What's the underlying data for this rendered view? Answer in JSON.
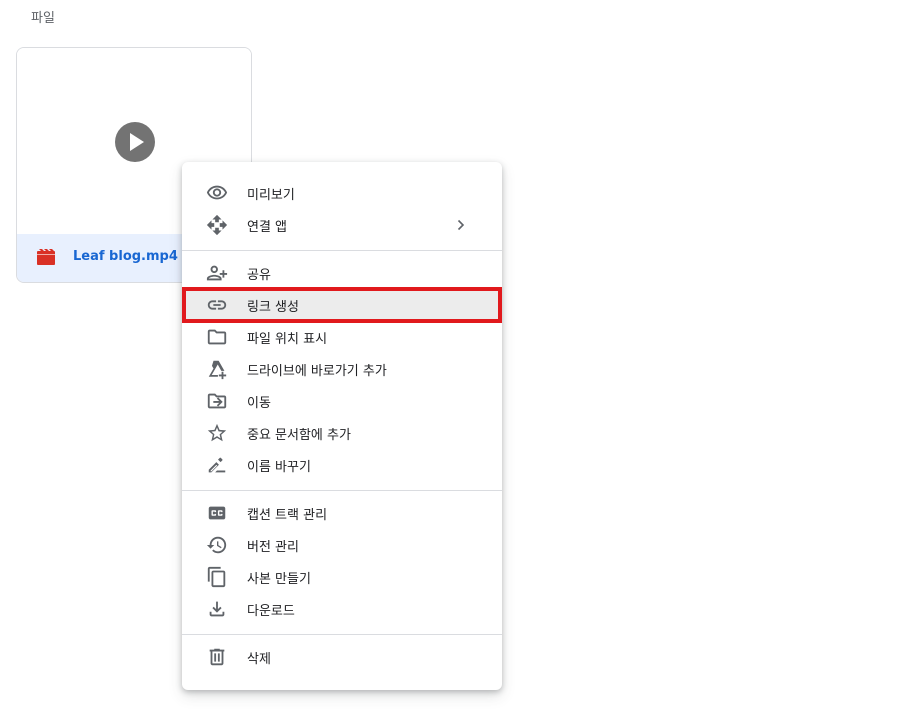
{
  "section": {
    "title": "파일"
  },
  "file_card": {
    "name": "Leaf blog.mp4",
    "type_icon": "video-file-icon",
    "thumbnail_icon": "play-icon"
  },
  "context_menu": {
    "items": [
      {
        "label": "미리보기",
        "icon": "eye-icon"
      },
      {
        "label": "연결 앱",
        "icon": "open-with-icon",
        "submenu": true
      },
      {
        "label": "공유",
        "icon": "person-add-icon"
      },
      {
        "label": "링크 생성",
        "icon": "link-icon",
        "highlighted": true
      },
      {
        "label": "파일 위치 표시",
        "icon": "folder-icon"
      },
      {
        "label": "드라이브에 바로가기 추가",
        "icon": "drive-shortcut-icon"
      },
      {
        "label": "이동",
        "icon": "move-to-folder-icon"
      },
      {
        "label": "중요 문서함에 추가",
        "icon": "star-icon"
      },
      {
        "label": "이름 바꾸기",
        "icon": "rename-pencil-icon"
      },
      {
        "label": "캡션 트랙 관리",
        "icon": "closed-caption-icon"
      },
      {
        "label": "버전 관리",
        "icon": "history-icon"
      },
      {
        "label": "사본 만들기",
        "icon": "copy-icon"
      },
      {
        "label": "다운로드",
        "icon": "download-icon"
      },
      {
        "label": "삭제",
        "icon": "trash-icon"
      }
    ]
  },
  "colors": {
    "accent": "#1967d2",
    "selected_background": "#e8f0fe",
    "highlight_outline": "#e1191d",
    "icon_gray": "#5f6368",
    "video_icon_red": "#d93025"
  }
}
